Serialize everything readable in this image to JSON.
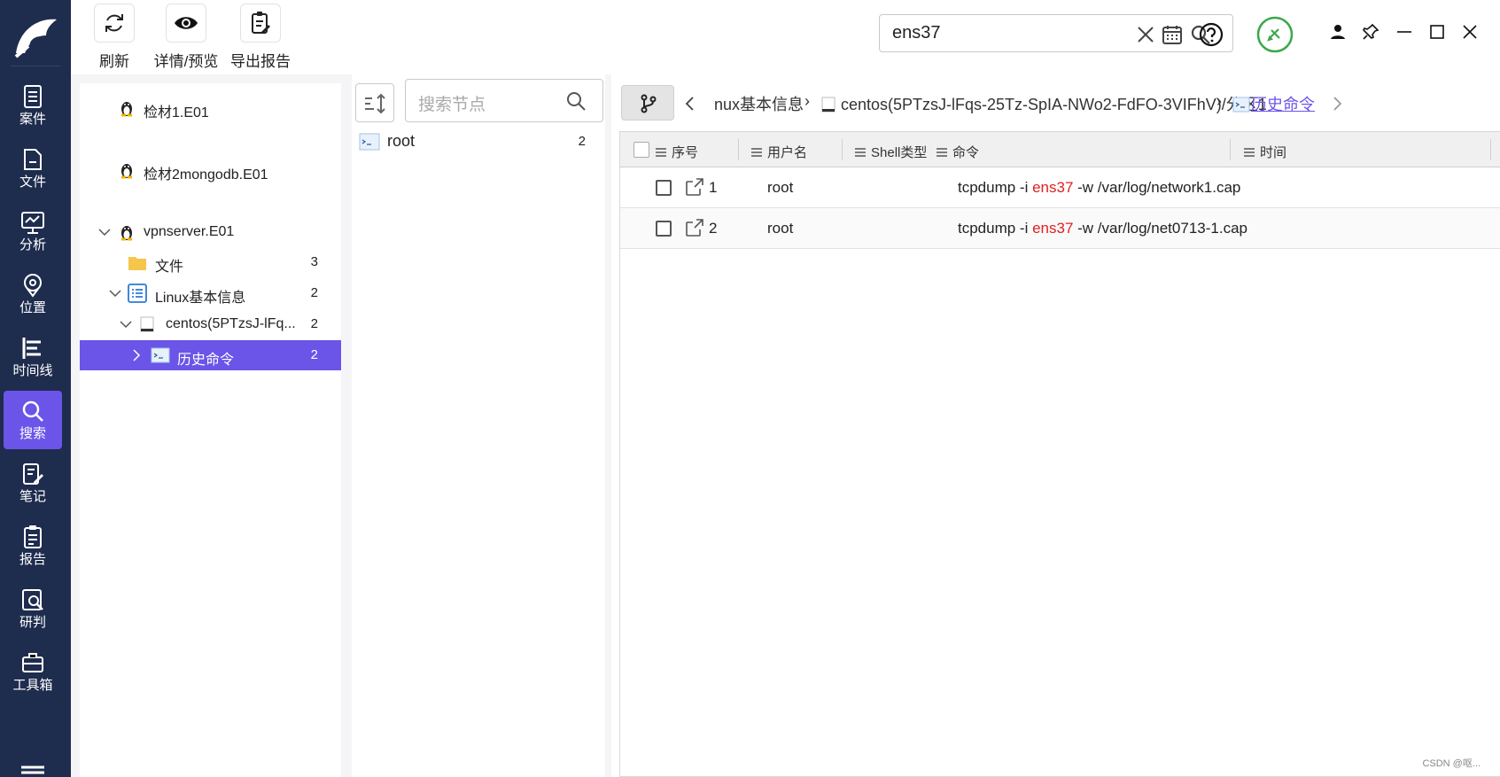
{
  "nav": {
    "items": [
      {
        "label": "案件",
        "icon": "case-doc-icon"
      },
      {
        "label": "文件",
        "icon": "file-icon"
      },
      {
        "label": "分析",
        "icon": "analysis-monitor-icon"
      },
      {
        "label": "位置",
        "icon": "location-pin-icon"
      },
      {
        "label": "时间线",
        "icon": "timeline-icon"
      },
      {
        "label": "搜索",
        "icon": "search-icon"
      },
      {
        "label": "笔记",
        "icon": "note-edit-icon"
      },
      {
        "label": "报告",
        "icon": "clipboard-report-icon"
      },
      {
        "label": "研判",
        "icon": "judge-search-icon"
      },
      {
        "label": "工具箱",
        "icon": "toolbox-icon"
      }
    ],
    "active": "搜索",
    "active_color": "#6b54e8",
    "background": "#1e2c4e"
  },
  "toolbar": {
    "refresh_label": "刷新",
    "preview_label": "详情/预览",
    "export_label": "导出报告"
  },
  "search": {
    "value": "ens37"
  },
  "tree": {
    "items": [
      {
        "label": "检材1.E01",
        "icon": "linux-penguin-icon"
      },
      {
        "label": "检材2mongodb.E01",
        "icon": "linux-penguin-icon"
      },
      {
        "label": "vpnserver.E01",
        "icon": "linux-penguin-icon"
      },
      {
        "label": "文件",
        "count": "3",
        "icon": "folder-icon"
      },
      {
        "label": "Linux基本信息",
        "count": "2",
        "icon": "list-doc-icon"
      },
      {
        "label": "centos(5PTzsJ-lFq...",
        "count": "2",
        "icon": "disk-icon"
      },
      {
        "label": "历史命令",
        "count": "2",
        "icon": "terminal-icon"
      }
    ],
    "selected": "历史命令"
  },
  "nodes": {
    "search_placeholder": "搜索节点",
    "items": [
      {
        "label": "root",
        "count": "2"
      }
    ]
  },
  "breadcrumb": {
    "items": [
      "nux基本信息",
      "centos(5PTzsJ-lFqs-25Tz-SpIA-NWo2-FdFO-3VIFhV)/分区1",
      "历史命令"
    ]
  },
  "table": {
    "columns": [
      "序号",
      "用户名",
      "Shell类型",
      "命令",
      "时间"
    ],
    "rows": [
      {
        "index": "1",
        "user": "root",
        "shell": "",
        "cmd_pre": "tcpdump -i ",
        "cmd_hl": "ens37",
        "cmd_post": " -w /var/log/network1.cap",
        "time": ""
      },
      {
        "index": "2",
        "user": "root",
        "shell": "",
        "cmd_pre": "tcpdump -i ",
        "cmd_hl": "ens37",
        "cmd_post": " -w /var/log/net0713-1.cap",
        "time": ""
      }
    ],
    "highlight_color": "#e02020"
  },
  "footer": {
    "watermark": "CSDN @呕..."
  }
}
